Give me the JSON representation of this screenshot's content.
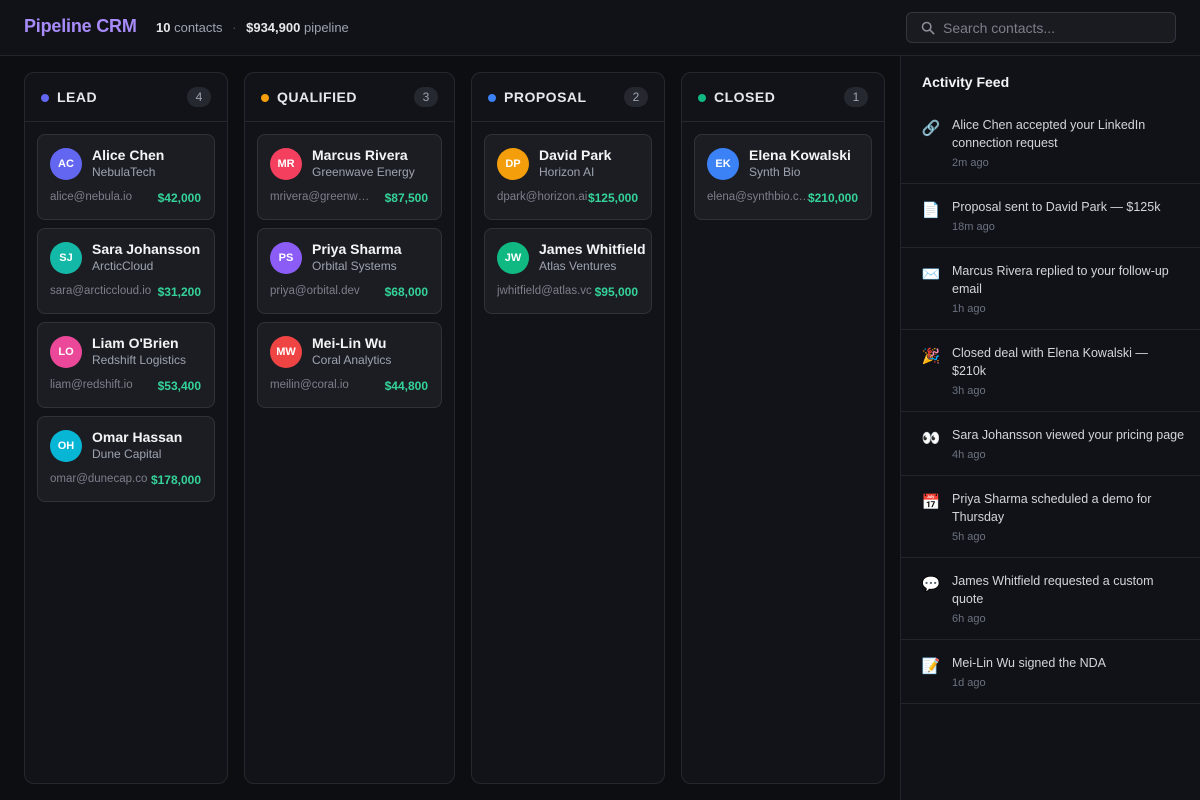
{
  "app": {
    "title": "Pipeline CRM",
    "contacts_count": "10",
    "contacts_label": "contacts",
    "pipeline_value": "$934,900",
    "pipeline_label": "pipeline"
  },
  "search": {
    "placeholder": "Search contacts..."
  },
  "columns": [
    {
      "title": "LEAD",
      "count": "4",
      "color": "#6366f1",
      "cards": [
        {
          "initials": "AC",
          "name": "Alice Chen",
          "company": "NebulaTech",
          "email": "alice@nebula.io",
          "value": "$42,000",
          "color": "#6366f1"
        },
        {
          "initials": "SJ",
          "name": "Sara Johansson",
          "company": "ArcticCloud",
          "email": "sara@arcticcloud.io",
          "value": "$31,200",
          "color": "#14b8a6"
        },
        {
          "initials": "LO",
          "name": "Liam O'Brien",
          "company": "Redshift Logistics",
          "email": "liam@redshift.io",
          "value": "$53,400",
          "color": "#ec4899"
        },
        {
          "initials": "OH",
          "name": "Omar Hassan",
          "company": "Dune Capital",
          "email": "omar@dunecap.co",
          "value": "$178,000",
          "color": "#06b6d4"
        }
      ]
    },
    {
      "title": "QUALIFIED",
      "count": "3",
      "color": "#f59e0b",
      "cards": [
        {
          "initials": "MR",
          "name": "Marcus Rivera",
          "company": "Greenwave Energy",
          "email": "mrivera@greenwave.com",
          "value": "$87,500",
          "color": "#f43f5e"
        },
        {
          "initials": "PS",
          "name": "Priya Sharma",
          "company": "Orbital Systems",
          "email": "priya@orbital.dev",
          "value": "$68,000",
          "color": "#8b5cf6"
        },
        {
          "initials": "MW",
          "name": "Mei-Lin Wu",
          "company": "Coral Analytics",
          "email": "meilin@coral.io",
          "value": "$44,800",
          "color": "#ef4444"
        }
      ]
    },
    {
      "title": "PROPOSAL",
      "count": "2",
      "color": "#3b82f6",
      "cards": [
        {
          "initials": "DP",
          "name": "David Park",
          "company": "Horizon AI",
          "email": "dpark@horizon.ai",
          "value": "$125,000",
          "color": "#f59e0b"
        },
        {
          "initials": "JW",
          "name": "James Whitfield",
          "company": "Atlas Ventures",
          "email": "jwhitfield@atlas.vc",
          "value": "$95,000",
          "color": "#10b981"
        }
      ]
    },
    {
      "title": "CLOSED",
      "count": "1",
      "color": "#10b981",
      "cards": [
        {
          "initials": "EK",
          "name": "Elena Kowalski",
          "company": "Synth Bio",
          "email": "elena@synthbio.com",
          "value": "$210,000",
          "color": "#3b82f6"
        }
      ]
    }
  ],
  "activity": {
    "title": "Activity Feed",
    "items": [
      {
        "icon": "link-icon",
        "glyph": "🔗",
        "text": "Alice Chen accepted your LinkedIn connection request",
        "time": "2m ago"
      },
      {
        "icon": "document-icon",
        "glyph": "📄",
        "text": "Proposal sent to David Park — $125k",
        "time": "18m ago"
      },
      {
        "icon": "envelope-icon",
        "glyph": "✉️",
        "text": "Marcus Rivera replied to your follow-up email",
        "time": "1h ago"
      },
      {
        "icon": "party-popper-icon",
        "glyph": "🎉",
        "text": "Closed deal with Elena Kowalski — $210k",
        "time": "3h ago"
      },
      {
        "icon": "eyes-icon",
        "glyph": "👀",
        "text": "Sara Johansson viewed your pricing page",
        "time": "4h ago"
      },
      {
        "icon": "calendar-icon",
        "glyph": "📅",
        "text": "Priya Sharma scheduled a demo for Thursday",
        "time": "5h ago"
      },
      {
        "icon": "speech-bubble-icon",
        "glyph": "💬",
        "text": "James Whitfield requested a custom quote",
        "time": "6h ago"
      },
      {
        "icon": "memo-icon",
        "glyph": "📝",
        "text": "Mei-Lin Wu signed the NDA",
        "time": "1d ago"
      }
    ]
  }
}
